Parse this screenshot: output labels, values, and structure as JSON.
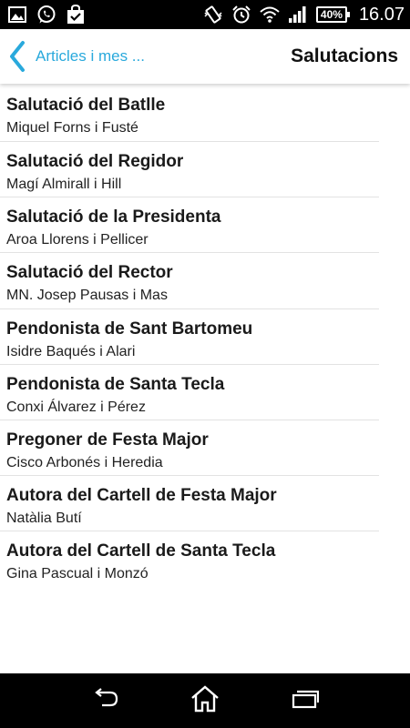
{
  "status_bar": {
    "left_icons": [
      "image-icon",
      "whatsapp-icon",
      "shopping-bag-icon"
    ],
    "right_icons": [
      "vibrate-icon",
      "alarm-icon",
      "wifi-icon",
      "signal-icon"
    ],
    "battery": "40%",
    "time": "16.07"
  },
  "header": {
    "back_label": "Articles i mes ...",
    "title": "Salutacions",
    "accent_color": "#29a9dc"
  },
  "items": [
    {
      "title": "Salutació del Batlle",
      "subtitle": "Miquel Forns i Fusté"
    },
    {
      "title": "Salutació del Regidor",
      "subtitle": "Magí Almirall i Hill"
    },
    {
      "title": "Salutació de la Presidenta",
      "subtitle": "Aroa Llorens i Pellicer"
    },
    {
      "title": "Salutació del Rector",
      "subtitle": "MN. Josep Pausas i Mas"
    },
    {
      "title": "Pendonista de Sant Bartomeu",
      "subtitle": "Isidre Baqués i Alari"
    },
    {
      "title": "Pendonista de Santa Tecla",
      "subtitle": "Conxi Álvarez i Pérez"
    },
    {
      "title": "Pregoner de Festa Major",
      "subtitle": "Cisco Arbonés i Heredia"
    },
    {
      "title": "Autora del Cartell de Festa Major",
      "subtitle": "Natàlia Butí"
    },
    {
      "title": "Autora del Cartell de Santa Tecla",
      "subtitle": "Gina Pascual i Monzó"
    }
  ],
  "nav_bar": {
    "buttons": [
      "back-icon",
      "home-icon",
      "recent-apps-icon"
    ]
  }
}
